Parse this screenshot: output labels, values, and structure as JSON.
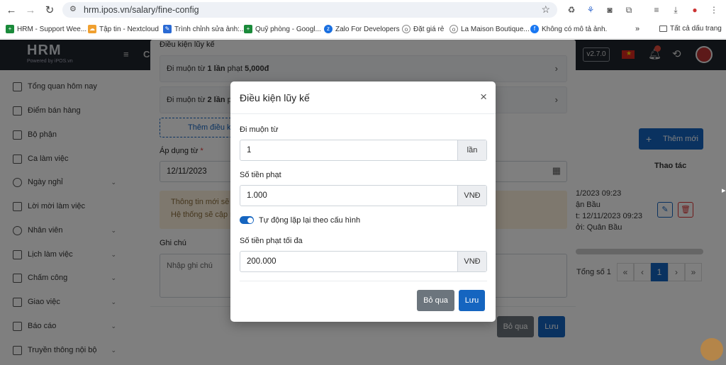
{
  "browser": {
    "url": "hrm.ipos.vn/salary/fine-config",
    "bookmarks": [
      {
        "label": "HRM - Support Wee...",
        "color": "#1a8a3a"
      },
      {
        "label": "Tập tin - Nextcloud",
        "color": "#f0a030"
      },
      {
        "label": "Trình chỉnh sửa ảnh:...",
        "color": "#2a6ad4"
      },
      {
        "label": "Quỹ phòng - Googl...",
        "color": "#1a8a3a"
      },
      {
        "label": "Zalo For Developers",
        "color": "#1a6fe0"
      },
      {
        "label": "Đặt giá rẻ",
        "color": "#666666"
      },
      {
        "label": "La Maison Boutique...",
        "color": "#666666"
      },
      {
        "label": "Không có mô tả ảnh.",
        "color": "#1877f2"
      }
    ],
    "all_bookmarks": "Tất cả dấu trang"
  },
  "app": {
    "logo": "HRM",
    "logo_sub": "Powered by iPOS.vn",
    "topnav_item": "C",
    "version": "v2.7.0"
  },
  "sidebar": {
    "items": [
      {
        "label": "Tổng quan hôm nay",
        "chevron": false
      },
      {
        "label": "Điểm bán hàng",
        "chevron": false
      },
      {
        "label": "Bộ phận",
        "chevron": false
      },
      {
        "label": "Ca làm việc",
        "chevron": false
      },
      {
        "label": "Ngày nghỉ",
        "chevron": true
      },
      {
        "label": "Lời mời làm việc",
        "chevron": false
      },
      {
        "label": "Nhân viên",
        "chevron": true
      },
      {
        "label": "Lịch làm việc",
        "chevron": true
      },
      {
        "label": "Chấm công",
        "chevron": true
      },
      {
        "label": "Giao việc",
        "chevron": true
      },
      {
        "label": "Báo cáo",
        "chevron": true
      },
      {
        "label": "Truyền thông nội bộ",
        "chevron": true
      }
    ]
  },
  "page": {
    "add_new": "Thêm mới",
    "actions_header": "Thao tác",
    "row_lines": [
      "1/2023 09:23",
      "ận Bầu",
      "t: 12/11/2023 09:23",
      "ởi: Quân Bầu"
    ],
    "total": "Tổng số 1",
    "pager": [
      "«",
      "‹",
      "1",
      "›",
      "»"
    ]
  },
  "panel": {
    "section_title": "Điều kiện lũy kế",
    "rows": [
      {
        "prefix": "Đi muộn từ ",
        "bold": "1 lần",
        "mid": " phạt ",
        "amount": "5,000đ"
      },
      {
        "prefix": "Đi muộn từ ",
        "bold": "2 lần",
        "mid": " ph",
        "amount": ""
      }
    ],
    "add_condition": "Thêm điều ki",
    "apply_from_label": "Áp dụng từ",
    "required_mark": "*",
    "apply_from_value": "12/11/2023",
    "info_line1": "Thông tin mới sẽ c",
    "info_line2": "Hệ thống sẽ cập n",
    "note_label": "Ghi chú",
    "note_placeholder": "Nhập ghi chú",
    "cancel": "Bỏ qua",
    "save": "Lưu"
  },
  "modal": {
    "title": "Điều kiện lũy kế",
    "from_label": "Đi muộn từ",
    "from_value": "1",
    "from_unit": "lần",
    "fine_label": "Số tiền phạt",
    "fine_value": "1.000",
    "currency": "VNĐ",
    "toggle_label": "Tự động lặp lại theo cấu hình",
    "toggle_on": true,
    "max_label": "Số tiền phạt tối đa",
    "max_value": "200.000",
    "cancel": "Bỏ qua",
    "save": "Lưu"
  },
  "colors": {
    "primary": "#1565c0",
    "secondary": "#6c757d",
    "topnav": "#1e242d",
    "warning_bg": "#fdf1dd"
  }
}
